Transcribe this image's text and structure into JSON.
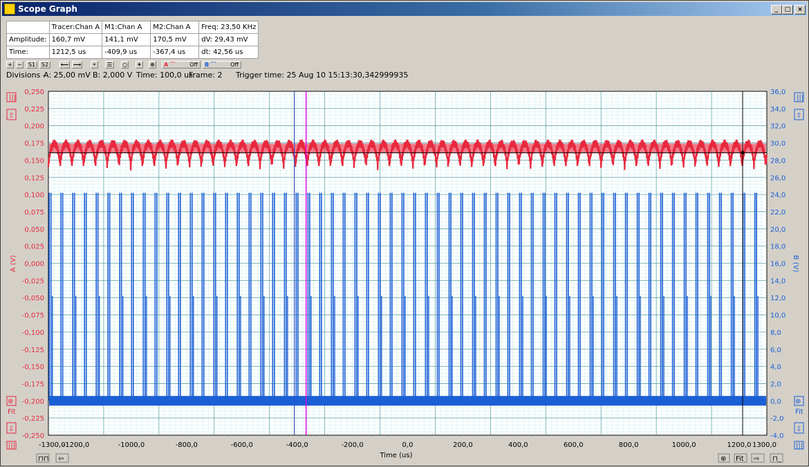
{
  "window": {
    "title": "Scope Graph"
  },
  "readout": {
    "headers": [
      "Tracer:Chan A",
      "M1:Chan A",
      "M2:Chan A",
      "Freq: 23,50 KHz"
    ],
    "rows": [
      {
        "label": "Amplitude:",
        "values": [
          "160,7 mV",
          "141,1 mV",
          "170,5 mV",
          "dV: 29,43 mV"
        ]
      },
      {
        "label": "Time:",
        "values": [
          "1212,5 us",
          "-409,9 us",
          "-367,4 us",
          "dt:  42,56 us"
        ]
      }
    ]
  },
  "toolbar": {
    "s1": "S1",
    "s2": "S2",
    "chan_a_label": "A",
    "chan_a_state": "Off",
    "chan_b_label": "B",
    "chan_b_state": "Off"
  },
  "divisions": {
    "label": "Divisions -",
    "a": "A: 25,00 mV",
    "b": "B: 2,000 V",
    "time": "Time: 100,0 us",
    "frame": "Frame: 2",
    "trigger": "Trigger time: 25 Aug 10 15:13:30,342999935"
  },
  "side_buttons": {
    "fit_left": "Fit",
    "fit_right": "Fit",
    "fit_bottom": "Fit"
  },
  "colors": {
    "chan_a": "#e8293f",
    "chan_b": "#1b5fd6",
    "grid": "#7fd0d0",
    "marker_m2": "#e000e0",
    "marker_m1": "#3050c0",
    "tracer": "#000000"
  },
  "chart_data": {
    "type": "line",
    "xlabel": "Time (us)",
    "ylabel_left": "A (V)",
    "ylabel_right": "B (V)",
    "xlim": [
      -1300,
      1300
    ],
    "ylim_left": [
      -0.25,
      0.25
    ],
    "ylim_right": [
      -4,
      36
    ],
    "x_ticks": [
      "-1300,0",
      "-1200,0",
      "-1000,0",
      "-800,0",
      "-600,0",
      "-400,0",
      "-200,0",
      "0,0",
      "200,0",
      "400,0",
      "600,0",
      "800,0",
      "1000,0",
      "1200,0",
      "1300,0"
    ],
    "x_tick_values": [
      -1300,
      -1200,
      -1000,
      -800,
      -600,
      -400,
      -200,
      0,
      200,
      400,
      600,
      800,
      1000,
      1200,
      1300
    ],
    "y_left_ticks": [
      "0,250",
      "0,225",
      "0,200",
      "0,175",
      "0,150",
      "0,125",
      "0,100",
      "0,075",
      "0,050",
      "0,025",
      "0,000",
      "-0,025",
      "-0,050",
      "-0,075",
      "-0,100",
      "-0,125",
      "-0,150",
      "-0,175",
      "-0,200",
      "-0,225",
      "-0,250"
    ],
    "y_right_ticks": [
      "36,0",
      "34,0",
      "32,0",
      "30,0",
      "28,0",
      "26,0",
      "24,0",
      "22,0",
      "20,0",
      "18,0",
      "16,0",
      "14,0",
      "12,0",
      "10,0",
      "8,0",
      "6,0",
      "4,0",
      "2,0",
      "0,0",
      "-2,0",
      "-4,0"
    ],
    "grid": true,
    "series": [
      {
        "name": "Chan A",
        "axis": "left",
        "pattern": "periodic ripple",
        "period_us": 42.56,
        "high": 0.174,
        "low": 0.14,
        "mean": 0.16
      },
      {
        "name": "Chan B",
        "axis": "right",
        "pattern": "pulse train",
        "period_us": 42.56,
        "baseline": 0.0,
        "peak": 24.2,
        "mid_level": 12.2
      }
    ],
    "markers": [
      {
        "name": "Tracer",
        "x": 1212.5
      },
      {
        "name": "M1",
        "x": -409.9
      },
      {
        "name": "M2",
        "x": -367.4
      }
    ],
    "tracer_level_a": 0.1607
  }
}
